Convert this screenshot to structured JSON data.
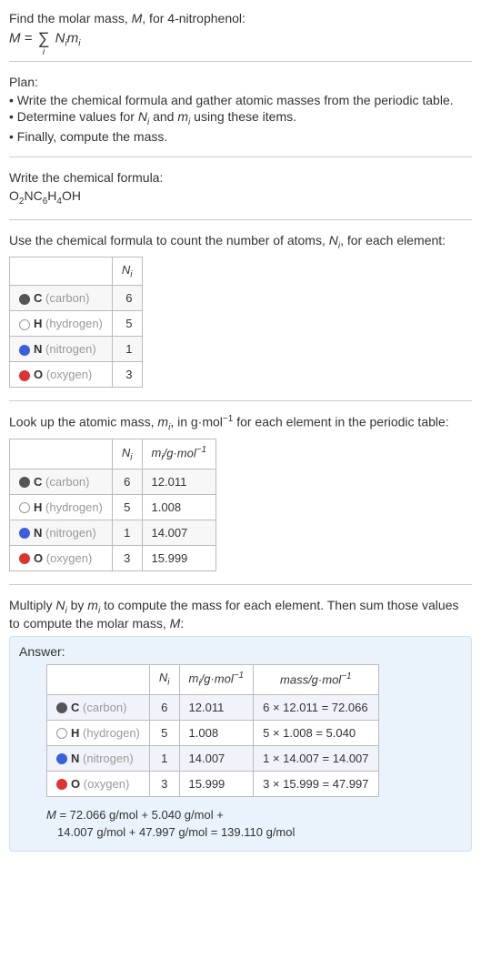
{
  "intro": {
    "line1_prefix": "Find the molar mass, ",
    "line1_var": "M",
    "line1_suffix": ", for 4-nitrophenol:",
    "formula_lhs": "M",
    "formula_eq": " = ",
    "formula_sum_index": "i",
    "formula_Ni": "N",
    "formula_Ni_sub": "i",
    "formula_mi": "m",
    "formula_mi_sub": "i"
  },
  "plan": {
    "heading": "Plan:",
    "b1": "• Write the chemical formula and gather atomic masses from the periodic table.",
    "b2_prefix": "• Determine values for ",
    "b2_N": "N",
    "b2_Ni_sub": "i",
    "b2_and": " and ",
    "b2_m": "m",
    "b2_mi_sub": "i",
    "b2_suffix": " using these items.",
    "b3": "• Finally, compute the mass."
  },
  "chem": {
    "heading": "Write the chemical formula:",
    "formula": "O₂NC₆H₄OH",
    "o": "O",
    "o2": "2",
    "n": "N",
    "c": "C",
    "c6": "6",
    "h": "H",
    "h4": "4",
    "oh_o": "O",
    "oh_h": "H"
  },
  "count": {
    "heading_prefix": "Use the chemical formula to count the number of atoms, ",
    "heading_N": "N",
    "heading_N_sub": "i",
    "heading_suffix": ", for each element:",
    "header_Ni": "Nᵢ",
    "rows": [
      {
        "sym": "C",
        "name": "(carbon)",
        "n": "6",
        "sw": "sw-c"
      },
      {
        "sym": "H",
        "name": "(hydrogen)",
        "n": "5",
        "sw": "sw-h"
      },
      {
        "sym": "N",
        "name": "(nitrogen)",
        "n": "1",
        "sw": "sw-n"
      },
      {
        "sym": "O",
        "name": "(oxygen)",
        "n": "3",
        "sw": "sw-o"
      }
    ]
  },
  "mass": {
    "heading_prefix": "Look up the atomic mass, ",
    "heading_m": "m",
    "heading_m_sub": "i",
    "heading_mid": ", in g·mol",
    "heading_exp": "−1",
    "heading_suffix": " for each element in the periodic table:",
    "header_Ni": "Nᵢ",
    "header_mi": "mᵢ/g·mol⁻¹",
    "rows": [
      {
        "sym": "C",
        "name": "(carbon)",
        "n": "6",
        "m": "12.011",
        "sw": "sw-c"
      },
      {
        "sym": "H",
        "name": "(hydrogen)",
        "n": "5",
        "m": "1.008",
        "sw": "sw-h"
      },
      {
        "sym": "N",
        "name": "(nitrogen)",
        "n": "1",
        "m": "14.007",
        "sw": "sw-n"
      },
      {
        "sym": "O",
        "name": "(oxygen)",
        "n": "3",
        "m": "15.999",
        "sw": "sw-o"
      }
    ]
  },
  "multiply": {
    "line_prefix": "Multiply ",
    "N": "N",
    "N_sub": "i",
    "by": " by ",
    "m": "m",
    "m_sub": "i",
    "mid": " to compute the mass for each element. Then sum those values to compute the molar mass, ",
    "Mvar": "M",
    "colon": ":"
  },
  "answer": {
    "heading": "Answer:",
    "header_Ni": "Nᵢ",
    "header_mi": "mᵢ/g·mol⁻¹",
    "header_mass": "mass/g·mol⁻¹",
    "rows": [
      {
        "sym": "C",
        "name": "(carbon)",
        "n": "6",
        "m": "12.011",
        "calc": "6 × 12.011 = 72.066",
        "sw": "sw-c"
      },
      {
        "sym": "H",
        "name": "(hydrogen)",
        "n": "5",
        "m": "1.008",
        "calc": "5 × 1.008 = 5.040",
        "sw": "sw-h"
      },
      {
        "sym": "N",
        "name": "(nitrogen)",
        "n": "1",
        "m": "14.007",
        "calc": "1 × 14.007 = 14.007",
        "sw": "sw-n"
      },
      {
        "sym": "O",
        "name": "(oxygen)",
        "n": "3",
        "m": "15.999",
        "calc": "3 × 15.999 = 47.997",
        "sw": "sw-o"
      }
    ],
    "final_l1": "M = 72.066 g/mol + 5.040 g/mol +",
    "final_l2": "14.007 g/mol + 47.997 g/mol = 139.110 g/mol"
  }
}
